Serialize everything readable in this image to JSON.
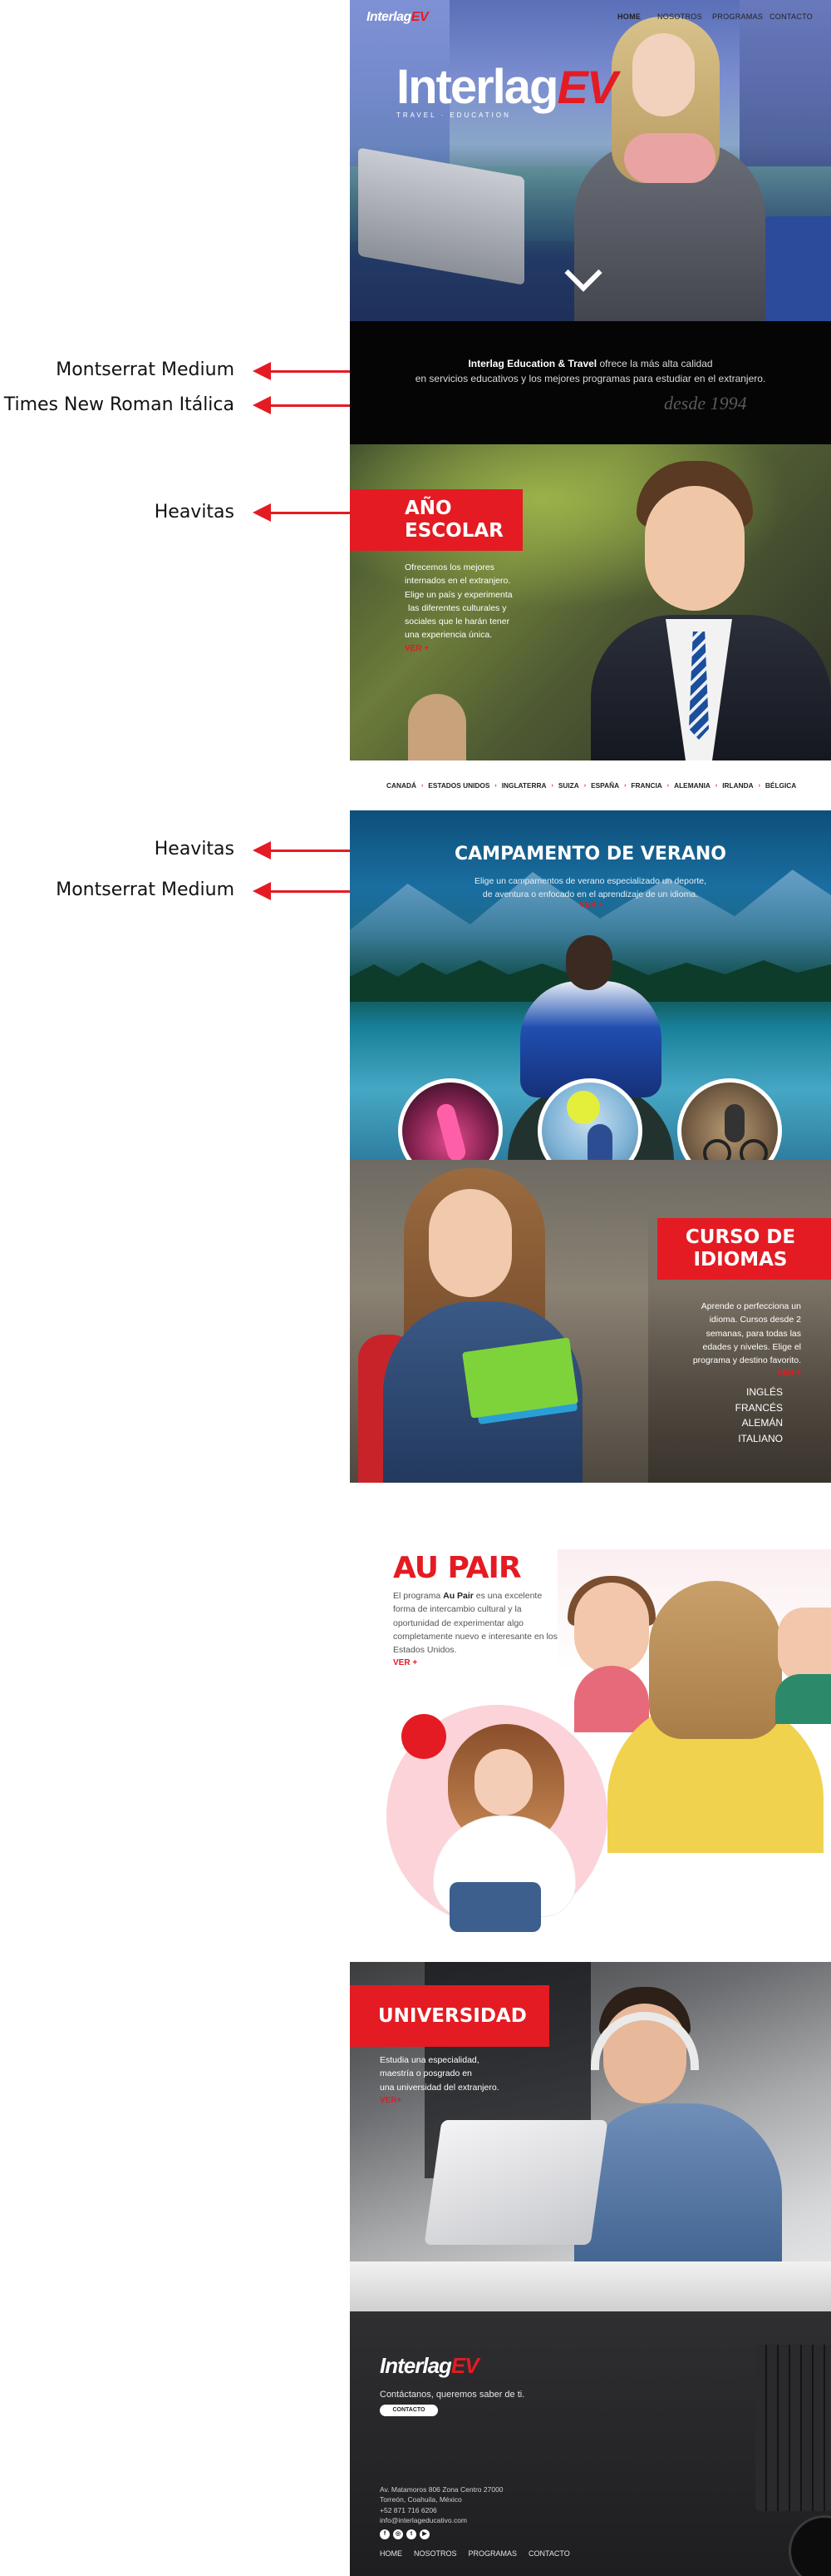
{
  "annotations": [
    {
      "label": "Montserrat Medium"
    },
    {
      "label": "Times New Roman Itálica"
    },
    {
      "label": "Heavitas"
    },
    {
      "label": "Heavitas"
    },
    {
      "label": "Montserrat Medium"
    }
  ],
  "header": {
    "logo_text": "Interlag",
    "logo_mark": "EV",
    "nav": [
      "HOME",
      "NOSOTROS",
      "PROGRAMAS",
      "CONTACTO"
    ]
  },
  "hero": {
    "logo_text": "Interlag",
    "logo_mark": "EV",
    "logo_tagline": "TRAVEL · EDUCATION",
    "scroll_icon": "chevron-down-icon"
  },
  "intro": {
    "brand": "Interlag Education & Travel",
    "line1_rest": " ofrece la más alta calidad",
    "line2": "en servicios educativos y los mejores programas para estudiar en el extranjero.",
    "since": "desde 1994"
  },
  "anio_escolar": {
    "title_line1": "AÑO",
    "title_line2": "ESCOLAR",
    "text_lines": [
      "Ofrecemos los mejores",
      "internados en el extranjero.",
      "Elige un país y experimenta",
      "las diferentes culturales y",
      "sociales que le harán tener",
      "una experiencia única."
    ],
    "more": "VER +"
  },
  "countries": [
    "CANADÁ",
    "ESTADOS UNIDOS",
    "INGLATERRA",
    "SUIZA",
    "ESPAÑA",
    "FRANCIA",
    "ALEMANIA",
    "IRLANDA",
    "BÉLGICA"
  ],
  "campamento": {
    "title": "CAMPAMENTO DE VERANO",
    "text_line1": "Elige un campamentos de verano especializado un deporte,",
    "text_line2": "de aventura o enfocado en el aprendizaje de un idioma.",
    "more": "VER +"
  },
  "curso": {
    "title_line1": "CURSO DE",
    "title_line2": "IDIOMAS",
    "text_lines": [
      "Aprende o perfecciona un",
      "idioma. Cursos desde 2",
      "semanas, para todas las",
      "edades y niveles. Elige el",
      "programa y destino favorito."
    ],
    "more": "VER +",
    "languages": [
      "INGLÉS",
      "FRANCÉS",
      "ALEMÁN",
      "ITALIANO"
    ]
  },
  "aupair": {
    "title": "AU PAIR",
    "text_prefix": "El programa ",
    "text_bold": "Au Pair",
    "text_suffix": " es una excelente forma de intercambio cultural y la oportunidad de experimentar algo completamente nuevo e interesante en los Estados Unidos.",
    "more": "VER +"
  },
  "universidad": {
    "title": "UNIVERSIDAD",
    "text_lines": [
      "Estudia una especialidad,",
      "maestría o posgrado en",
      "una universidad del extranjero."
    ],
    "more": "VER+"
  },
  "footer": {
    "logo_text": "Interlag",
    "logo_mark": "EV",
    "contact_text": "Contáctanos, queremos saber de ti.",
    "contact_button": "CONTACTO",
    "address_lines": [
      "Av. Matamoros 806 Zona Centro 27000",
      "Torreón, Coahuila, México",
      "+52 871 716 6206",
      "info@interlageducativo.com"
    ],
    "social": [
      {
        "icon": "facebook-icon",
        "glyph": "f"
      },
      {
        "icon": "instagram-icon",
        "glyph": "◎"
      },
      {
        "icon": "twitter-icon",
        "glyph": "t"
      },
      {
        "icon": "youtube-icon",
        "glyph": "▶"
      }
    ],
    "nav": [
      "HOME",
      "NOSOTROS",
      "PROGRAMAS",
      "CONTACTO"
    ]
  },
  "colors": {
    "accent_red": "#e41b23",
    "intro_bg": "#050505",
    "footer_bg": "#2a2a2c"
  }
}
